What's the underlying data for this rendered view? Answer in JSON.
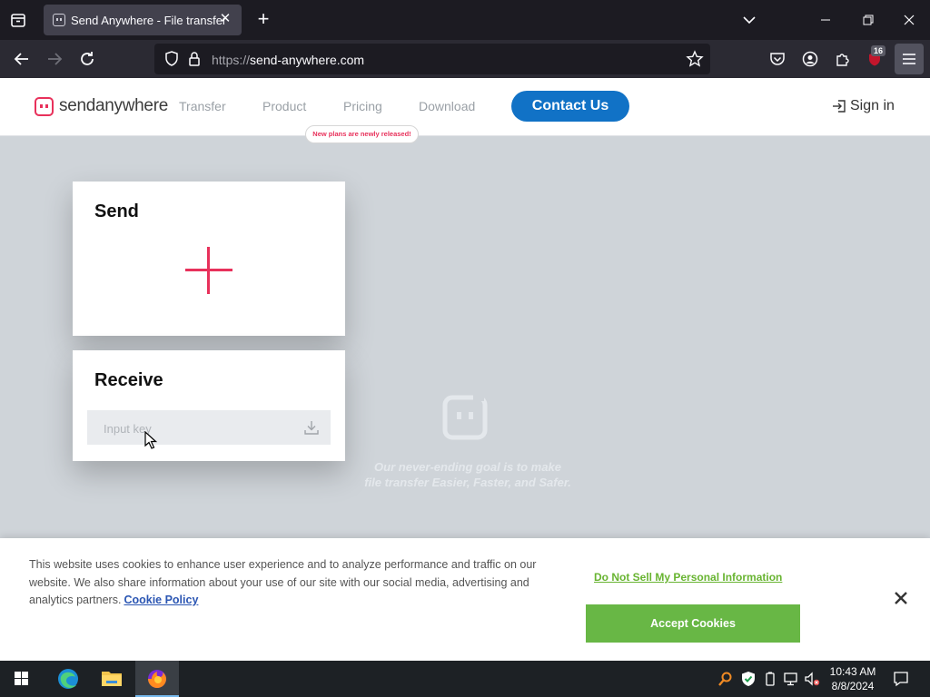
{
  "browser": {
    "tab_title": "Send Anywhere - File transfer",
    "url_prefix": "https://",
    "url_host": "send-anywhere.com",
    "extension_badge": "16"
  },
  "site": {
    "logo_text": "sendanywhere",
    "nav": [
      "Transfer",
      "Product",
      "Pricing",
      "Download"
    ],
    "pricing_badge": "New plans are newly released!",
    "contact_label": "Contact Us",
    "signin_label": "Sign in",
    "send_title": "Send",
    "receive_title": "Receive",
    "key_placeholder": "Input key",
    "slogan_line1": "Our never-ending goal is to make",
    "slogan_line2": "file transfer Easier, Faster, and Safer.",
    "accent_color": "#e8315b",
    "brand_blue": "#1172c6"
  },
  "cookie": {
    "text": "This website uses cookies to enhance user experience and to analyze performance and traffic on our website. We also share information about your use of our site with our social media, advertising and analytics partners.",
    "policy_link": "Cookie Policy",
    "do_not_sell": "Do Not Sell My Personal Information",
    "accept": "Accept Cookies",
    "accept_color": "#68b745"
  },
  "taskbar": {
    "time": "10:43 AM",
    "date": "8/8/2024",
    "pinned": [
      "start-icon",
      "edge-icon",
      "file-explorer-icon",
      "firefox-icon"
    ]
  }
}
